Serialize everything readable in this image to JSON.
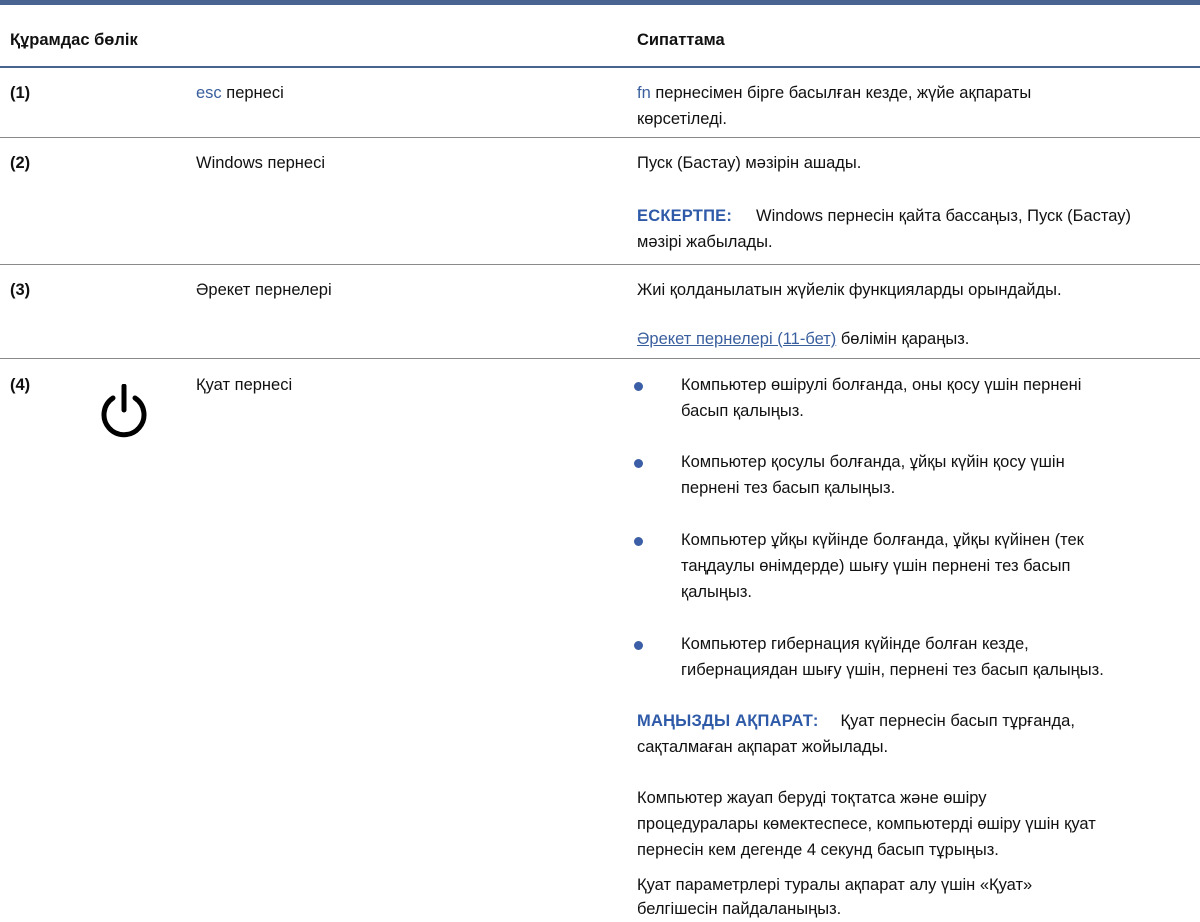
{
  "header": {
    "col_component": "Құрамдас бөлік",
    "col_description": "Сипаттама"
  },
  "rows": [
    {
      "num": "(1)",
      "name_prefix": "esc",
      "name_suffix": " пернесі",
      "desc_prefix": "fn",
      "desc_line1_rest": " пернесімен бірге басылған кезде, жүйе ақпараты",
      "desc_line2": "көрсетіледі."
    },
    {
      "num": "(2)",
      "name": "Windows пернесі",
      "desc": "Пуск (Бастау) мәзірін ашады.",
      "note_label": "ЕСКЕРТПЕ:",
      "note_line1": "Windows пернесін қайта бассаңыз, Пуск (Бастау)",
      "note_line2": "мәзірі жабылады."
    },
    {
      "num": "(3)",
      "name": "Әрекет пернелері",
      "desc": "Жиі қолданылатын жүйелік функцияларды орындайды.",
      "link": "Әрекет пернелері (11-бет)",
      "link_suffix": " бөлімін қараңыз."
    },
    {
      "num": "(4)",
      "icon": "power-icon",
      "name": "Қуат пернесі",
      "bullets": [
        [
          "Компьютер өшірулі болғанда, оны қосу үшін пернені",
          "басып қалыңыз."
        ],
        [
          "Компьютер қосулы болғанда, ұйқы күйін қосу үшін",
          "пернені тез басып қалыңыз."
        ],
        [
          "Компьютер ұйқы күйінде болғанда, ұйқы күйінен (тек",
          "таңдаулы өнімдерде) шығу үшін пернені тез басып",
          "қалыңыз."
        ],
        [
          "Компьютер гибернация күйінде болған кезде,",
          "гибернациядан шығу үшін, пернені тез басып қалыңыз."
        ]
      ],
      "important_label": "МАҢЫЗДЫ АҚПАРАТ:",
      "important_line1": "Қуат пернесін басып тұрғанда,",
      "important_line2": "сақталмаған ақпарат жойылады.",
      "para1": [
        "Компьютер жауап беруді тоқтатса және өшіру",
        "процедуралары көмектеспесе, компьютерді өшіру үшін қуат",
        "пернесін кем дегенде 4 секунд басып тұрыңыз."
      ],
      "para2": [
        "Қуат параметрлері туралы ақпарат алу үшін «Қуат»",
        "белгішесін пайдаланыңыз."
      ]
    }
  ],
  "colors": {
    "rule": "#4a6491",
    "label_blue": "#2e5aa8",
    "link_blue": "#3a5f9e",
    "bullet": "#3b5ea6"
  }
}
